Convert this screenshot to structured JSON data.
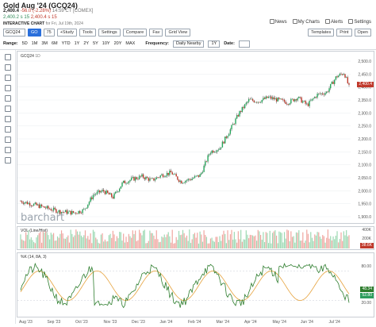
{
  "header": {
    "title": "Gold Aug '24 (GCQ24)",
    "last": "2,400.4",
    "change": "-56.0 (-2.28%)",
    "time": "14:59 CT [COMEX]",
    "post": "2,400.2 s 15",
    "ah_change": "2,400.4 s 15"
  },
  "chart_label": "INTERACTIVE CHART",
  "chart_date": "for Fri, Jul 19th, 2024",
  "links": [
    "News",
    "My Charts",
    "Alerts",
    "Settings"
  ],
  "toolbar": {
    "symbol": "GCQ24",
    "go": "GO",
    "sym_toggle": "75",
    "buttons": [
      "+Study",
      "Tools",
      "Settings",
      "Compare",
      "Fav",
      "Grid View"
    ],
    "right": [
      "Templates",
      "Print",
      "Open"
    ]
  },
  "range": {
    "label": "Range:",
    "options": [
      "5D",
      "1M",
      "3M",
      "6M",
      "YTD",
      "1Y",
      "2Y",
      "5Y",
      "10Y",
      "20Y",
      "MAX"
    ],
    "freq_label": "Frequency:",
    "freq": "Daily Nearby",
    "period": "1Y",
    "date_label": "Date:"
  },
  "panels": {
    "price": "GCQ24",
    "price_period": "1D",
    "vol": "VOL (Line/Hist)",
    "stoch": "%K (14, 8A, 3)",
    "brand": "barchart"
  },
  "yaxis": {
    "price": [
      "2,500.0",
      "2,450.0",
      "2,400.0",
      "2,350.0",
      "2,300.0",
      "2,250.0",
      "2,200.0",
      "2,150.0",
      "2,100.0",
      "2,050.0",
      "2,000.0",
      "1,950.0",
      "1,900.0"
    ],
    "vol": [
      "400K",
      "200K"
    ],
    "stoch": [
      "80.00",
      "20.00"
    ]
  },
  "tags": {
    "price": "2,400.4",
    "vol": "38.6K",
    "vol2": "35.6K",
    "k": "48.34",
    "d": "52.80"
  },
  "xaxis": [
    "Aug '23",
    "Sep '23",
    "Oct '23",
    "Nov '23",
    "Dec '23",
    "Jan '24",
    "Feb '24",
    "Mar '24",
    "Apr '24",
    "May '24",
    "Jun '24",
    "Jul '24"
  ],
  "colors": {
    "up": "#26a65b",
    "down": "#c0392b",
    "vol_up": "#9dd9b3",
    "vol_down": "#f0a6a0",
    "k": "#2d7d2d",
    "d": "#e6a23c",
    "fill": "#7f6ae6"
  }
}
